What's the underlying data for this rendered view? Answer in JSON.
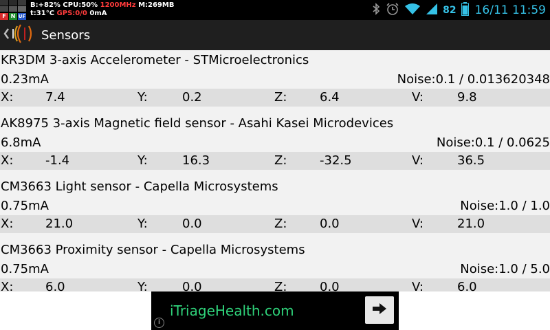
{
  "status_bar": {
    "flags": [
      "F",
      "N",
      "UF"
    ],
    "line1": {
      "battery_info": "B:+82%",
      "cpu": "CPU:50%",
      "freq": "1200MHz",
      "mem": "M:269MB"
    },
    "line2": {
      "temp": "t:31°C",
      "gps": "GPS:0/0",
      "current": "0mA"
    },
    "battery_level": "82",
    "clock": "16/11 11:59",
    "icons": [
      "bluetooth-icon",
      "alarm-icon",
      "wifi-icon",
      "signal-icon",
      "battery-icon"
    ]
  },
  "action_bar": {
    "title": "Sensors",
    "icons": [
      "back-icon",
      "app-logo-icon"
    ]
  },
  "sensors": [
    {
      "name": "KR3DM 3-axis Accelerometer - STMicroelectronics",
      "power": "0.23mA",
      "noise": "Noise:0.1 / 0.013620348",
      "x_label": "X:",
      "x": "7.4",
      "y_label": "Y:",
      "y": "0.2",
      "z_label": "Z:",
      "z": "6.4",
      "v_label": "V:",
      "v": "9.8"
    },
    {
      "name": "AK8975 3-axis Magnetic field sensor - Asahi Kasei Microdevices",
      "power": "6.8mA",
      "noise": "Noise:0.1 / 0.0625",
      "x_label": "X:",
      "x": "-1.4",
      "y_label": "Y:",
      "y": "16.3",
      "z_label": "Z:",
      "z": "-32.5",
      "v_label": "V:",
      "v": "36.5"
    },
    {
      "name": "CM3663 Light sensor - Capella Microsystems",
      "power": "0.75mA",
      "noise": "Noise:1.0 / 1.0",
      "x_label": "X:",
      "x": "21.0",
      "y_label": "Y:",
      "y": "0.0",
      "z_label": "Z:",
      "z": "0.0",
      "v_label": "V:",
      "v": "21.0"
    },
    {
      "name": "CM3663 Proximity sensor - Capella Microsystems",
      "power": "0.75mA",
      "noise": "Noise:1.0 / 5.0",
      "x_label": "X:",
      "x": "6.0",
      "y_label": "Y:",
      "y": "0.0",
      "z_label": "Z:",
      "z": "0.0",
      "v_label": "V:",
      "v": "6.0"
    }
  ],
  "ad": {
    "text": "iTriageHealth.com",
    "info_icon": "info-icon",
    "arrow_icon": "arrow-right-icon",
    "colors": {
      "text": "#2fd27a",
      "background": "#000000"
    }
  },
  "colors": {
    "clock": "#35c1e6",
    "row_background": "#dedede",
    "list_background": "#f2f2f2"
  }
}
